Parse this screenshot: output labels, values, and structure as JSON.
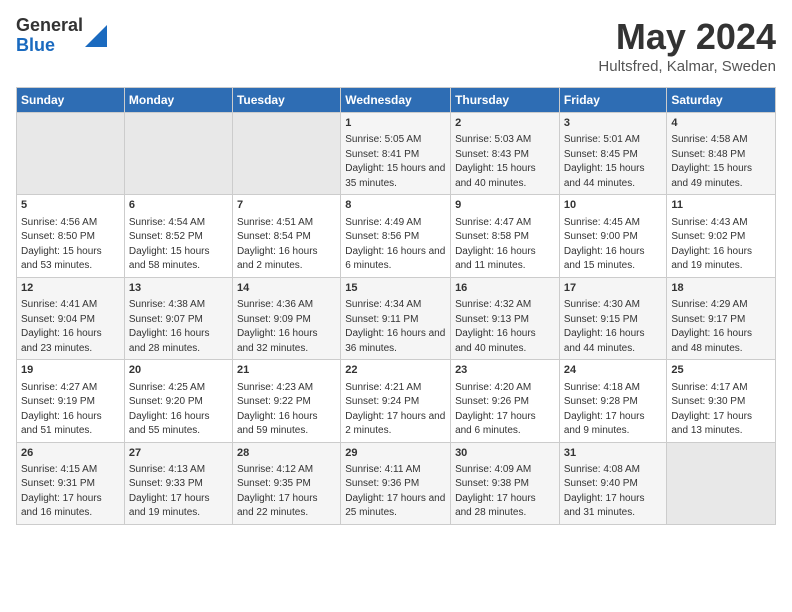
{
  "logo": {
    "general": "General",
    "blue": "Blue"
  },
  "title": {
    "month_year": "May 2024",
    "location": "Hultsfred, Kalmar, Sweden"
  },
  "days_of_week": [
    "Sunday",
    "Monday",
    "Tuesday",
    "Wednesday",
    "Thursday",
    "Friday",
    "Saturday"
  ],
  "weeks": [
    [
      {
        "day": "",
        "content": ""
      },
      {
        "day": "",
        "content": ""
      },
      {
        "day": "",
        "content": ""
      },
      {
        "day": "1",
        "content": "Sunrise: 5:05 AM\nSunset: 8:41 PM\nDaylight: 15 hours and 35 minutes."
      },
      {
        "day": "2",
        "content": "Sunrise: 5:03 AM\nSunset: 8:43 PM\nDaylight: 15 hours and 40 minutes."
      },
      {
        "day": "3",
        "content": "Sunrise: 5:01 AM\nSunset: 8:45 PM\nDaylight: 15 hours and 44 minutes."
      },
      {
        "day": "4",
        "content": "Sunrise: 4:58 AM\nSunset: 8:48 PM\nDaylight: 15 hours and 49 minutes."
      }
    ],
    [
      {
        "day": "5",
        "content": "Sunrise: 4:56 AM\nSunset: 8:50 PM\nDaylight: 15 hours and 53 minutes."
      },
      {
        "day": "6",
        "content": "Sunrise: 4:54 AM\nSunset: 8:52 PM\nDaylight: 15 hours and 58 minutes."
      },
      {
        "day": "7",
        "content": "Sunrise: 4:51 AM\nSunset: 8:54 PM\nDaylight: 16 hours and 2 minutes."
      },
      {
        "day": "8",
        "content": "Sunrise: 4:49 AM\nSunset: 8:56 PM\nDaylight: 16 hours and 6 minutes."
      },
      {
        "day": "9",
        "content": "Sunrise: 4:47 AM\nSunset: 8:58 PM\nDaylight: 16 hours and 11 minutes."
      },
      {
        "day": "10",
        "content": "Sunrise: 4:45 AM\nSunset: 9:00 PM\nDaylight: 16 hours and 15 minutes."
      },
      {
        "day": "11",
        "content": "Sunrise: 4:43 AM\nSunset: 9:02 PM\nDaylight: 16 hours and 19 minutes."
      }
    ],
    [
      {
        "day": "12",
        "content": "Sunrise: 4:41 AM\nSunset: 9:04 PM\nDaylight: 16 hours and 23 minutes."
      },
      {
        "day": "13",
        "content": "Sunrise: 4:38 AM\nSunset: 9:07 PM\nDaylight: 16 hours and 28 minutes."
      },
      {
        "day": "14",
        "content": "Sunrise: 4:36 AM\nSunset: 9:09 PM\nDaylight: 16 hours and 32 minutes."
      },
      {
        "day": "15",
        "content": "Sunrise: 4:34 AM\nSunset: 9:11 PM\nDaylight: 16 hours and 36 minutes."
      },
      {
        "day": "16",
        "content": "Sunrise: 4:32 AM\nSunset: 9:13 PM\nDaylight: 16 hours and 40 minutes."
      },
      {
        "day": "17",
        "content": "Sunrise: 4:30 AM\nSunset: 9:15 PM\nDaylight: 16 hours and 44 minutes."
      },
      {
        "day": "18",
        "content": "Sunrise: 4:29 AM\nSunset: 9:17 PM\nDaylight: 16 hours and 48 minutes."
      }
    ],
    [
      {
        "day": "19",
        "content": "Sunrise: 4:27 AM\nSunset: 9:19 PM\nDaylight: 16 hours and 51 minutes."
      },
      {
        "day": "20",
        "content": "Sunrise: 4:25 AM\nSunset: 9:20 PM\nDaylight: 16 hours and 55 minutes."
      },
      {
        "day": "21",
        "content": "Sunrise: 4:23 AM\nSunset: 9:22 PM\nDaylight: 16 hours and 59 minutes."
      },
      {
        "day": "22",
        "content": "Sunrise: 4:21 AM\nSunset: 9:24 PM\nDaylight: 17 hours and 2 minutes."
      },
      {
        "day": "23",
        "content": "Sunrise: 4:20 AM\nSunset: 9:26 PM\nDaylight: 17 hours and 6 minutes."
      },
      {
        "day": "24",
        "content": "Sunrise: 4:18 AM\nSunset: 9:28 PM\nDaylight: 17 hours and 9 minutes."
      },
      {
        "day": "25",
        "content": "Sunrise: 4:17 AM\nSunset: 9:30 PM\nDaylight: 17 hours and 13 minutes."
      }
    ],
    [
      {
        "day": "26",
        "content": "Sunrise: 4:15 AM\nSunset: 9:31 PM\nDaylight: 17 hours and 16 minutes."
      },
      {
        "day": "27",
        "content": "Sunrise: 4:13 AM\nSunset: 9:33 PM\nDaylight: 17 hours and 19 minutes."
      },
      {
        "day": "28",
        "content": "Sunrise: 4:12 AM\nSunset: 9:35 PM\nDaylight: 17 hours and 22 minutes."
      },
      {
        "day": "29",
        "content": "Sunrise: 4:11 AM\nSunset: 9:36 PM\nDaylight: 17 hours and 25 minutes."
      },
      {
        "day": "30",
        "content": "Sunrise: 4:09 AM\nSunset: 9:38 PM\nDaylight: 17 hours and 28 minutes."
      },
      {
        "day": "31",
        "content": "Sunrise: 4:08 AM\nSunset: 9:40 PM\nDaylight: 17 hours and 31 minutes."
      },
      {
        "day": "",
        "content": ""
      }
    ]
  ]
}
